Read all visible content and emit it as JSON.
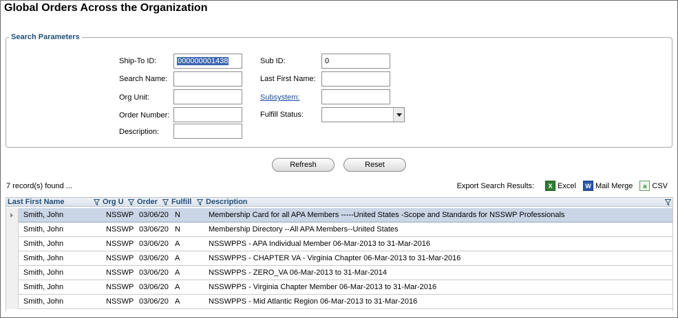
{
  "page": {
    "title": "Global Orders Across the Organization"
  },
  "search": {
    "legend": "Search Parameters",
    "ship_to_id": {
      "label": "Ship-To ID:",
      "value": "000000001438"
    },
    "search_name": {
      "label": "Search Name:",
      "value": ""
    },
    "org_unit": {
      "label": "Org Unit:",
      "value": ""
    },
    "order_number": {
      "label": "Order Number:",
      "value": ""
    },
    "description": {
      "label": "Description:",
      "value": ""
    },
    "sub_id": {
      "label": "Sub ID:",
      "value": "0"
    },
    "last_first_name": {
      "label": "Last First Name:",
      "value": ""
    },
    "subsystem": {
      "label": "Subsystem:",
      "value": ""
    },
    "fulfill_status": {
      "label": "Fulfill Status:",
      "value": ""
    }
  },
  "actions": {
    "refresh": "Refresh",
    "reset": "Reset"
  },
  "results": {
    "count_text": "7 record(s) found ...",
    "export_label": "Export Search Results:",
    "export_excel": "Excel",
    "export_mail_merge": "Mail Merge",
    "export_csv": "CSV"
  },
  "grid": {
    "headers": {
      "last_first_name": "Last First Name",
      "org_unit": "Org U",
      "order": "Order",
      "fulfill": "Fulfill",
      "description": "Description"
    },
    "rows": [
      {
        "name": "Smith, John",
        "org": "NSSWP",
        "order": "03/06/20",
        "fulfill": "N",
        "description": "Membership Card for all APA Members  -----United States -Scope and Standards for NSSWP Professionals"
      },
      {
        "name": "Smith, John",
        "org": "NSSWP",
        "order": "03/06/20",
        "fulfill": "N",
        "description": "Membership Directory  --All APA Members--United States"
      },
      {
        "name": "Smith, John",
        "org": "NSSWP",
        "order": "03/06/20",
        "fulfill": "A",
        "description": "NSSWPPS - APA Individual Member 06-Mar-2013 to 31-Mar-2016"
      },
      {
        "name": "Smith, John",
        "org": "NSSWP",
        "order": "03/06/20",
        "fulfill": "A",
        "description": "NSSWPPS - CHAPTER VA - Virginia Chapter 06-Mar-2013 to 31-Mar-2016"
      },
      {
        "name": "Smith, John",
        "org": "NSSWP",
        "order": "03/06/20",
        "fulfill": "A",
        "description": "NSSWPPS - ZERO_VA 06-Mar-2013 to 31-Mar-2014"
      },
      {
        "name": "Smith, John",
        "org": "NSSWP",
        "order": "03/06/20",
        "fulfill": "A",
        "description": "NSSWPPS - Virginia Chapter Member 06-Mar-2013 to 31-Mar-2016"
      },
      {
        "name": "Smith, John",
        "org": "NSSWP",
        "order": "03/06/20",
        "fulfill": "A",
        "description": "NSSWPPS - Mid Atlantic Region 06-Mar-2013 to 31-Mar-2016"
      }
    ]
  },
  "icons": {
    "filter": "filter-funnel-icon",
    "excel": "excel-icon",
    "mail_merge": "word-icon",
    "csv": "csv-icon",
    "dropdown": "chevron-down-icon",
    "row_pointer": "row-pointer-icon"
  },
  "colors": {
    "header_text": "#1f4e79",
    "selected_row": "#cad5e6",
    "link": "#1a4fa0"
  }
}
